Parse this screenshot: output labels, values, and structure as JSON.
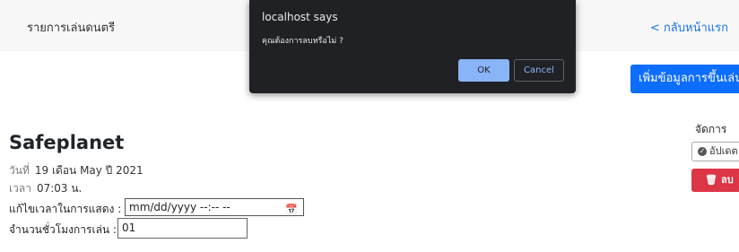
{
  "header": {
    "title": "รายการเล่นดนตรี",
    "back_link": "< กลับหน้าแรก"
  },
  "add_button": "เพิ่มข้อมูลการขึ้นเล่น",
  "event": {
    "band_name": "Safeplanet",
    "date_label": "วันที่",
    "date_value": "19 เดือน May ปี 2021",
    "time_label": "เวลา",
    "time_value": "07:03 น.",
    "edit_time_label": "แก้ไขเวลาในการแสดง :",
    "datetime_placeholder": "mm/dd/yyyy --:-- --",
    "hours_label": "จำนวนชั่วโมงการเล่น :",
    "hours_value": "01"
  },
  "manage": {
    "label": "จัดการ",
    "update_button": "อัปเดต",
    "delete_button": "ลบ"
  },
  "dialog": {
    "title": "localhost says",
    "message": "คุณต้องการลบหรือไม่ ?",
    "ok_label": "OK",
    "cancel_label": "Cancel"
  },
  "colors": {
    "primary": "#0d6efd",
    "danger": "#dc3545",
    "link": "#1a73e8",
    "dialog_bg": "#202124",
    "dialog_ok": "#8ab4f8"
  }
}
